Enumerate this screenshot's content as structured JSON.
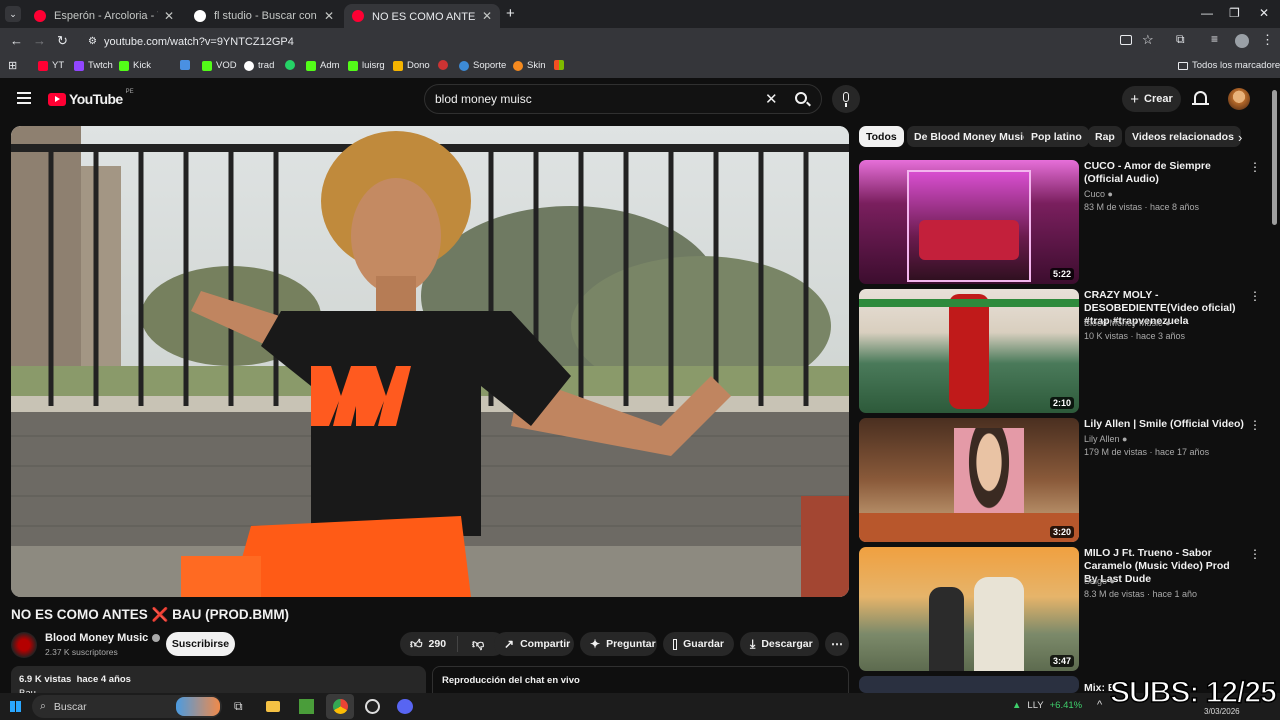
{
  "browser": {
    "tabs": [
      {
        "title": "Esperón - Arcoloria - YouTube",
        "favicon_color": "#ff0033"
      },
      {
        "title": "fl studio - Buscar con Google",
        "favicon_color": "#ffffff"
      },
      {
        "title": "NO ES COMO ANTES ❌ BAU (PROD.BMM)",
        "favicon_color": "#ff0033"
      }
    ],
    "new_tab_icon": "plus-icon",
    "url": "youtube.com/watch?v=9YNTCZ12GP4",
    "bookmarks": [
      {
        "label": "YT",
        "color": "#ff0033"
      },
      {
        "label": "Twtch",
        "color": "#9146ff"
      },
      {
        "label": "Kick",
        "color": "#53fc18"
      },
      {
        "label": "",
        "color": "#4a90e2"
      },
      {
        "label": "VOD",
        "color": "#53fc18"
      },
      {
        "label": "trad",
        "color": "#ffffff"
      },
      {
        "label": "",
        "color": "#25d366"
      },
      {
        "label": "Adm",
        "color": "#53fc18"
      },
      {
        "label": "luisrg",
        "color": "#53fc18"
      },
      {
        "label": "Dono",
        "color": "#f5b400"
      },
      {
        "label": "",
        "color": "#cc3333"
      },
      {
        "label": "Soporte",
        "color": "#3d8bd6"
      },
      {
        "label": "Skin",
        "color": "#f58a1f"
      },
      {
        "label": "",
        "color": "#7fba00"
      }
    ],
    "all_bookmarks": "Todos los marcadores"
  },
  "youtube": {
    "logo_text": "YouTube",
    "region": "PE",
    "search_query": "blod money muisc",
    "create_label": "Crear",
    "video": {
      "title": "NO ES COMO ANTES ❌ BAU (PROD.BMM)",
      "channel": "Blood Money Music",
      "subscribers": "2.37 K suscriptores",
      "subscribe_label": "Suscribirse",
      "likes": "290",
      "share_label": "Compartir",
      "ask_label": "Preguntar",
      "save_label": "Guardar",
      "download_label": "Descargar",
      "views": "6.9 K vistas",
      "age": "hace 4 años",
      "desc_start": "Bau",
      "chat_replay": "Reproducción del chat en vivo"
    },
    "chips": [
      {
        "label": "Todos",
        "selected": true
      },
      {
        "label": "De Blood Money Music",
        "selected": false
      },
      {
        "label": "Pop latino",
        "selected": false
      },
      {
        "label": "Rap",
        "selected": false
      },
      {
        "label": "Videos relacionados",
        "selected": false
      }
    ],
    "recommendations": [
      {
        "title": "CUCO - Amor de Siempre (Official Audio)",
        "channel": "Cuco",
        "meta": "83 M de vistas · hace 8 años",
        "duration": "5:22"
      },
      {
        "title": "CRAZY MOLY - DESOBEDIENTE(Video oficial)  #trap #trapvenezuela",
        "channel": "Blood Money Music",
        "meta": "10 K vistas · hace 3 años",
        "duration": "2:10"
      },
      {
        "title": "Lily Allen | Smile (Official Video)",
        "channel": "Lily Allen",
        "meta": "179 M de vistas · hace 17 años",
        "duration": "3:20"
      },
      {
        "title": "MILO J Ft. Trueno  - Sabor Caramelo (Music Video) Prod By Last Dude",
        "channel": "Saigo",
        "meta": "8.3 M de vistas · hace 1 año",
        "duration": "3:47"
      },
      {
        "title": "Mix: B",
        "channel": "",
        "meta": "",
        "duration": ""
      }
    ]
  },
  "overlay": {
    "subs": "SUBS: 12/25"
  },
  "taskbar": {
    "search_placeholder": "Buscar",
    "ticker": "LLY",
    "change": "+6.41%",
    "date": "3/03/2026"
  },
  "colors": {
    "accent": "#ff0033",
    "background": "#0f0f0f",
    "positive": "#3ecf6b"
  }
}
